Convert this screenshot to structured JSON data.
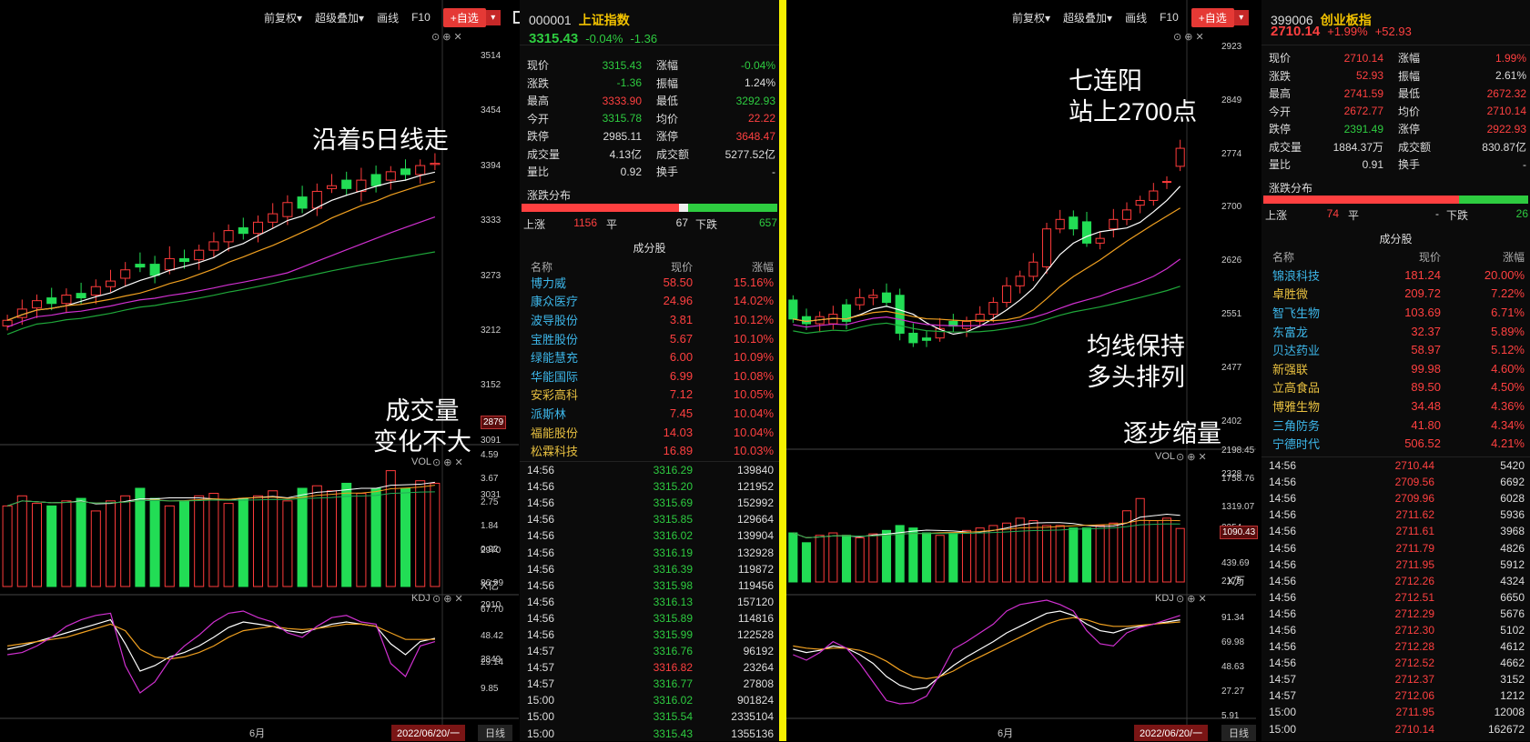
{
  "left": {
    "toolbar": {
      "fq": "前复权▾",
      "overlay": "超级叠加▾",
      "draw": "画线",
      "f10": "F10",
      "add": "+自选",
      "add_arrow": "▾"
    },
    "kpanel_ctrl": "⊙ ⊕ ✕",
    "price_axis": [
      "3514",
      "3454",
      "3394",
      "3333",
      "3273",
      "3212",
      "3152",
      "3091",
      "3031",
      "2970",
      "2910",
      "2849"
    ],
    "price_axis_box": "2879",
    "vol_label": "VOL",
    "vol_ctrl": "⊙ ⊕ ✕",
    "vol_axis": [
      "4.59",
      "3.67",
      "2.75",
      "1.84",
      "0.92"
    ],
    "vol_unit": "X亿",
    "kdj_label": "KDJ",
    "kdj_ctrl": "⊙ ⊕ ✕",
    "kdj_axis": [
      "86.99",
      "67.70",
      "48.42",
      "29.14",
      "9.85"
    ],
    "month_label": "6月",
    "date_box": "2022/06/20/一",
    "period_btn": "日线",
    "annot1": "沿着5日线走",
    "annot2_line1": "成交量",
    "annot2_line2": "变化不大",
    "quote": {
      "code": "000001",
      "name": "上证指数",
      "price": "3315.43",
      "pct": "-0.04%",
      "chg": "-1.36",
      "rows": [
        {
          "l1": "现价",
          "v1": "3315.43",
          "c1": "green",
          "l2": "涨幅",
          "v2": "-0.04%",
          "c2": "green"
        },
        {
          "l1": "涨跌",
          "v1": "-1.36",
          "c1": "green",
          "l2": "振幅",
          "v2": "1.24%",
          "c2": "white"
        },
        {
          "l1": "最高",
          "v1": "3333.90",
          "c1": "red",
          "l2": "最低",
          "v2": "3292.93",
          "c2": "green"
        },
        {
          "l1": "今开",
          "v1": "3315.78",
          "c1": "green",
          "l2": "均价",
          "v2": "22.22",
          "c2": "red"
        },
        {
          "l1": "跌停",
          "v1": "2985.11",
          "c1": "white",
          "l2": "涨停",
          "v2": "3648.47",
          "c2": "red"
        },
        {
          "l1": "成交量",
          "v1": "4.13亿",
          "c1": "white",
          "l2": "成交额",
          "v2": "5277.52亿",
          "c2": "white"
        },
        {
          "l1": "量比",
          "v1": "0.92",
          "c1": "white",
          "l2": "换手",
          "v2": "-",
          "c2": "white"
        }
      ],
      "dist_title": "涨跌分布",
      "up_label": "上涨",
      "up": "1156",
      "flat_label": "平",
      "flat": "67",
      "down_label": "下跌",
      "down": "657",
      "cons_title": "成分股",
      "cons_hdr": [
        "名称",
        "现价",
        "涨幅"
      ],
      "cons": [
        {
          "n": "博力威",
          "p": "58.50",
          "c": "15.16%",
          "nc": "cyan"
        },
        {
          "n": "康众医疗",
          "p": "24.96",
          "c": "14.02%",
          "nc": "cyan"
        },
        {
          "n": "波导股份",
          "p": "3.81",
          "c": "10.12%",
          "nc": "cyan"
        },
        {
          "n": "宝胜股份",
          "p": "5.67",
          "c": "10.10%",
          "nc": "cyan"
        },
        {
          "n": "绿能慧充",
          "p": "6.00",
          "c": "10.09%",
          "nc": "cyan"
        },
        {
          "n": "华能国际",
          "p": "6.99",
          "c": "10.08%",
          "nc": "cyan"
        },
        {
          "n": "安彩高科",
          "p": "7.12",
          "c": "10.05%",
          "nc": "yel"
        },
        {
          "n": "派斯林",
          "p": "7.45",
          "c": "10.04%",
          "nc": "cyan"
        },
        {
          "n": "福能股份",
          "p": "14.03",
          "c": "10.04%",
          "nc": "yel"
        },
        {
          "n": "松霖科技",
          "p": "16.89",
          "c": "10.03%",
          "nc": "yel"
        }
      ],
      "ticks": [
        {
          "t": "14:56",
          "p": "3316.29",
          "v": "139840",
          "c": "green"
        },
        {
          "t": "14:56",
          "p": "3315.20",
          "v": "121952",
          "c": "green"
        },
        {
          "t": "14:56",
          "p": "3315.69",
          "v": "152992",
          "c": "green"
        },
        {
          "t": "14:56",
          "p": "3315.85",
          "v": "129664",
          "c": "green"
        },
        {
          "t": "14:56",
          "p": "3316.02",
          "v": "139904",
          "c": "green"
        },
        {
          "t": "14:56",
          "p": "3316.19",
          "v": "132928",
          "c": "green"
        },
        {
          "t": "14:56",
          "p": "3316.39",
          "v": "119872",
          "c": "green"
        },
        {
          "t": "14:56",
          "p": "3315.98",
          "v": "119456",
          "c": "green"
        },
        {
          "t": "14:56",
          "p": "3316.13",
          "v": "157120",
          "c": "green"
        },
        {
          "t": "14:56",
          "p": "3315.89",
          "v": "114816",
          "c": "green"
        },
        {
          "t": "14:56",
          "p": "3315.99",
          "v": "122528",
          "c": "green"
        },
        {
          "t": "14:57",
          "p": "3316.76",
          "v": "96192",
          "c": "green"
        },
        {
          "t": "14:57",
          "p": "3316.82",
          "v": "23264",
          "c": "red"
        },
        {
          "t": "14:57",
          "p": "3316.77",
          "v": "27808",
          "c": "green"
        },
        {
          "t": "15:00",
          "p": "3316.02",
          "v": "901824",
          "c": "green"
        },
        {
          "t": "15:00",
          "p": "3315.54",
          "v": "2335104",
          "c": "green"
        },
        {
          "t": "15:00",
          "p": "3315.43",
          "v": "1355136",
          "c": "green"
        }
      ]
    }
  },
  "right": {
    "toolbar": {
      "fq": "前复权▾",
      "overlay": "超级叠加▾",
      "draw": "画线",
      "f10": "F10",
      "add": "+自选",
      "add_arrow": "▾"
    },
    "kpanel_ctrl": "⊙ ⊕ ✕",
    "price_axis": [
      "2923",
      "2849",
      "2774",
      "2700",
      "2626",
      "2551",
      "2477",
      "2402",
      "2328",
      "2254",
      "2179"
    ],
    "vol_label": "VOL",
    "vol_ctrl": "⊙ ⊕ ✕",
    "vol_axis": [
      "2198.45",
      "1758.76",
      "1319.07",
      "879.38",
      "439.69"
    ],
    "vol_axis_box": "1090.43",
    "vol_unit": "X万",
    "kdj_label": "KDJ",
    "kdj_ctrl": "⊙ ⊕ ✕",
    "kdj_axis": [
      "91.34",
      "69.98",
      "48.63",
      "27.27",
      "5.91"
    ],
    "month_label": "6月",
    "date_box": "2022/06/20/一",
    "period_btn": "日线",
    "annot1_line1": "七连阳",
    "annot1_line2": "站上2700点",
    "annot2_line1": "均线保持",
    "annot2_line2": "多头排列",
    "annot3": "逐步缩量",
    "quote": {
      "code": "399006",
      "name": "创业板指",
      "price": "2710.14",
      "pct": "+1.99%",
      "chg": "+52.93",
      "rows": [
        {
          "l1": "现价",
          "v1": "2710.14",
          "c1": "red",
          "l2": "涨幅",
          "v2": "1.99%",
          "c2": "red"
        },
        {
          "l1": "涨跌",
          "v1": "52.93",
          "c1": "red",
          "l2": "振幅",
          "v2": "2.61%",
          "c2": "white"
        },
        {
          "l1": "最高",
          "v1": "2741.59",
          "c1": "red",
          "l2": "最低",
          "v2": "2672.32",
          "c2": "red"
        },
        {
          "l1": "今开",
          "v1": "2672.77",
          "c1": "red",
          "l2": "均价",
          "v2": "2710.14",
          "c2": "red"
        },
        {
          "l1": "跌停",
          "v1": "2391.49",
          "c1": "green",
          "l2": "涨停",
          "v2": "2922.93",
          "c2": "red"
        },
        {
          "l1": "成交量",
          "v1": "1884.37万",
          "c1": "white",
          "l2": "成交额",
          "v2": "830.87亿",
          "c2": "white"
        },
        {
          "l1": "量比",
          "v1": "0.91",
          "c1": "white",
          "l2": "换手",
          "v2": "-",
          "c2": "white"
        }
      ],
      "dist_title": "涨跌分布",
      "up_label": "上涨",
      "up": "74",
      "flat_label": "平",
      "flat": "-",
      "down_label": "下跌",
      "down": "26",
      "cons_title": "成分股",
      "cons_hdr": [
        "名称",
        "现价",
        "涨幅"
      ],
      "cons": [
        {
          "n": "锦浪科技",
          "p": "181.24",
          "c": "20.00%",
          "nc": "cyan"
        },
        {
          "n": "卓胜微",
          "p": "209.72",
          "c": "7.22%",
          "nc": "yel"
        },
        {
          "n": "智飞生物",
          "p": "103.69",
          "c": "6.71%",
          "nc": "cyan"
        },
        {
          "n": "东富龙",
          "p": "32.37",
          "c": "5.89%",
          "nc": "cyan"
        },
        {
          "n": "贝达药业",
          "p": "58.97",
          "c": "5.12%",
          "nc": "cyan"
        },
        {
          "n": "新强联",
          "p": "99.98",
          "c": "4.60%",
          "nc": "yel"
        },
        {
          "n": "立高食品",
          "p": "89.50",
          "c": "4.50%",
          "nc": "yel"
        },
        {
          "n": "博雅生物",
          "p": "34.48",
          "c": "4.36%",
          "nc": "yel"
        },
        {
          "n": "三角防务",
          "p": "41.80",
          "c": "4.34%",
          "nc": "cyan"
        },
        {
          "n": "宁德时代",
          "p": "506.52",
          "c": "4.21%",
          "nc": "cyan"
        }
      ],
      "ticks": [
        {
          "t": "14:56",
          "p": "2710.44",
          "v": "5420",
          "c": "red"
        },
        {
          "t": "14:56",
          "p": "2709.56",
          "v": "6692",
          "c": "red"
        },
        {
          "t": "14:56",
          "p": "2709.96",
          "v": "6028",
          "c": "red"
        },
        {
          "t": "14:56",
          "p": "2711.62",
          "v": "5936",
          "c": "red"
        },
        {
          "t": "14:56",
          "p": "2711.61",
          "v": "3968",
          "c": "red"
        },
        {
          "t": "14:56",
          "p": "2711.79",
          "v": "4826",
          "c": "red"
        },
        {
          "t": "14:56",
          "p": "2711.95",
          "v": "5912",
          "c": "red"
        },
        {
          "t": "14:56",
          "p": "2712.26",
          "v": "4324",
          "c": "red"
        },
        {
          "t": "14:56",
          "p": "2712.51",
          "v": "6650",
          "c": "red"
        },
        {
          "t": "14:56",
          "p": "2712.29",
          "v": "5676",
          "c": "red"
        },
        {
          "t": "14:56",
          "p": "2712.30",
          "v": "5102",
          "c": "red"
        },
        {
          "t": "14:56",
          "p": "2712.28",
          "v": "4612",
          "c": "red"
        },
        {
          "t": "14:56",
          "p": "2712.52",
          "v": "4662",
          "c": "red"
        },
        {
          "t": "14:57",
          "p": "2712.37",
          "v": "3152",
          "c": "red"
        },
        {
          "t": "14:57",
          "p": "2712.06",
          "v": "1212",
          "c": "red"
        },
        {
          "t": "15:00",
          "p": "2711.95",
          "v": "12008",
          "c": "red"
        },
        {
          "t": "15:00",
          "p": "2710.14",
          "v": "162672",
          "c": "red"
        }
      ]
    }
  },
  "chart_data": [
    {
      "type": "candlestick",
      "index": "上证指数",
      "period": "日线",
      "price_axis_ticks": [
        3514,
        3454,
        3394,
        3333,
        3273,
        3212,
        3152,
        3091,
        3031,
        2970,
        2910,
        2849
      ],
      "closes": [
        3040,
        3060,
        3075,
        3070,
        3085,
        3080,
        3100,
        3110,
        3130,
        3135,
        3120,
        3150,
        3145,
        3165,
        3180,
        3200,
        3195,
        3215,
        3230,
        3250,
        3240,
        3270,
        3280,
        3275,
        3290,
        3280,
        3305,
        3300,
        3316,
        3320
      ],
      "opens": [
        3030,
        3045,
        3062,
        3080,
        3070,
        3088,
        3085,
        3100,
        3115,
        3140,
        3140,
        3130,
        3150,
        3148,
        3165,
        3180,
        3205,
        3195,
        3215,
        3225,
        3260,
        3240,
        3275,
        3290,
        3270,
        3300,
        3290,
        3310,
        3300,
        3318
      ],
      "volumes": [
        3.2,
        3.6,
        3.3,
        3.2,
        3.4,
        3.5,
        3.0,
        3.4,
        3.6,
        3.9,
        3.5,
        3.2,
        3.4,
        3.6,
        3.7,
        3.3,
        3.5,
        3.6,
        3.8,
        3.4,
        3.9,
        4.0,
        3.8,
        4.1,
        3.7,
        3.9,
        4.6,
        3.9,
        4.2,
        4.1
      ],
      "vol_axis_ticks": [
        4.59,
        3.67,
        2.75,
        1.84,
        0.92
      ],
      "kdj_axis_ticks": [
        86.99,
        67.7,
        48.42,
        29.14,
        9.85
      ],
      "k": [
        55,
        58,
        62,
        66,
        70,
        74,
        78,
        82,
        60,
        35,
        40,
        48,
        52,
        58,
        66,
        75,
        80,
        78,
        76,
        72,
        70,
        74,
        78,
        80,
        78,
        76,
        60,
        50,
        62,
        65
      ],
      "d": [
        58,
        60,
        62,
        64,
        66,
        70,
        74,
        78,
        72,
        55,
        48,
        46,
        48,
        52,
        58,
        66,
        72,
        74,
        76,
        74,
        73,
        74,
        76,
        78,
        78,
        76,
        70,
        64,
        64,
        64
      ],
      "j": [
        50,
        52,
        58,
        66,
        76,
        82,
        86,
        88,
        40,
        15,
        25,
        45,
        58,
        68,
        80,
        88,
        90,
        84,
        80,
        70,
        66,
        76,
        84,
        86,
        80,
        78,
        42,
        30,
        58,
        62
      ]
    },
    {
      "type": "candlestick",
      "index": "创业板指",
      "period": "日线",
      "price_axis_ticks": [
        2923,
        2849,
        2774,
        2700,
        2626,
        2551,
        2477,
        2402,
        2328,
        2254,
        2179
      ],
      "closes": [
        2350,
        2340,
        2355,
        2360,
        2345,
        2395,
        2400,
        2385,
        2320,
        2300,
        2305,
        2330,
        2335,
        2345,
        2360,
        2385,
        2420,
        2440,
        2470,
        2540,
        2560,
        2540,
        2510,
        2520,
        2560,
        2580,
        2600,
        2620,
        2640,
        2710
      ],
      "opens": [
        2390,
        2355,
        2340,
        2340,
        2380,
        2380,
        2395,
        2405,
        2400,
        2320,
        2310,
        2310,
        2345,
        2330,
        2345,
        2360,
        2385,
        2420,
        2440,
        2460,
        2540,
        2565,
        2555,
        2510,
        2540,
        2560,
        2590,
        2600,
        2640,
        2672
      ],
      "volumes": [
        1000,
        800,
        950,
        1000,
        950,
        900,
        980,
        1050,
        1150,
        1100,
        1000,
        950,
        1000,
        1050,
        1100,
        1150,
        1200,
        1300,
        1250,
        1150,
        1150,
        1100,
        1100,
        1150,
        1200,
        1450,
        1700,
        1250,
        1300,
        1090
      ],
      "vol_axis_ticks": [
        2198.45,
        1758.76,
        1319.07,
        879.38,
        439.69
      ],
      "kdj_axis_ticks": [
        91.34,
        69.98,
        48.63,
        27.27,
        5.91
      ],
      "k": [
        55,
        52,
        54,
        58,
        56,
        50,
        42,
        30,
        22,
        18,
        20,
        30,
        40,
        48,
        55,
        62,
        70,
        76,
        82,
        88,
        90,
        86,
        78,
        72,
        70,
        74,
        76,
        78,
        80,
        82
      ],
      "d": [
        58,
        56,
        55,
        56,
        56,
        54,
        50,
        44,
        36,
        30,
        28,
        30,
        35,
        42,
        48,
        54,
        60,
        66,
        72,
        78,
        82,
        84,
        82,
        78,
        76,
        76,
        77,
        78,
        79,
        80
      ],
      "j": [
        50,
        45,
        52,
        62,
        56,
        42,
        25,
        8,
        5,
        6,
        12,
        32,
        55,
        62,
        70,
        78,
        90,
        96,
        98,
        100,
        96,
        90,
        72,
        60,
        58,
        70,
        75,
        78,
        82,
        86
      ]
    }
  ]
}
